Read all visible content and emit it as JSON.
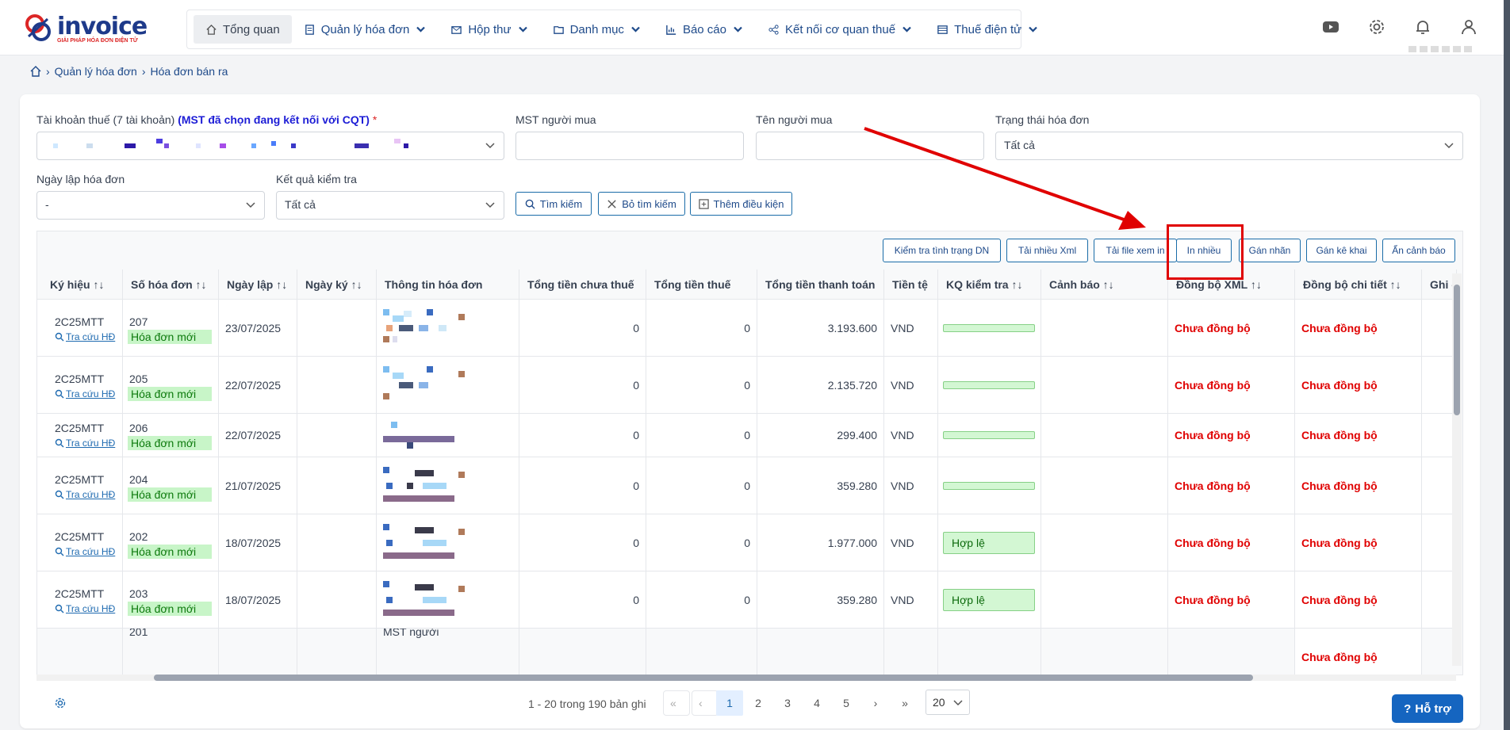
{
  "brand": {
    "name": "invoice",
    "tagline": "GIẢI PHÁP HÓA ĐƠN ĐIỆN TỬ"
  },
  "nav": {
    "items": [
      {
        "label": "Tổng quan",
        "icon": "home-icon"
      },
      {
        "label": "Quản lý hóa đơn",
        "icon": "invoice-icon"
      },
      {
        "label": "Hộp thư",
        "icon": "mail-icon"
      },
      {
        "label": "Danh mục",
        "icon": "folder-icon"
      },
      {
        "label": "Báo cáo",
        "icon": "chart-icon"
      },
      {
        "label": "Kết nối cơ quan thuế",
        "icon": "share-icon"
      },
      {
        "label": "Thuế điện tử",
        "icon": "list-icon"
      }
    ]
  },
  "breadcrumb": {
    "level1": "Quản lý hóa đơn",
    "level2": "Hóa đơn bán ra"
  },
  "filters": {
    "account_label": "Tài khoản thuế (7 tài khoản)",
    "account_highlight": "(MST đã chọn đang kết nối với CQT)",
    "required_mark": "*",
    "buyer_tax_label": "MST người mua",
    "buyer_tax_value": "",
    "buyer_name_label": "Tên người mua",
    "buyer_name_value": "",
    "status_label": "Trạng thái hóa đơn",
    "status_value": "Tất cả",
    "date_label": "Ngày lập hóa đơn",
    "date_value": "-",
    "check_label": "Kết quả kiểm tra",
    "check_value": "Tất cả",
    "search_btn": "Tìm kiếm",
    "clear_btn": "Bỏ tìm kiếm",
    "more_btn": "Thêm điều kiện"
  },
  "toolbar": {
    "check_status": "Kiểm tra tình trạng DN",
    "download_xml": "Tải nhiều Xml",
    "download_view": "Tải file xem in",
    "print_many": "In nhiều",
    "assign_label": "Gán nhãn",
    "assign_declare": "Gán kê khai",
    "hide_warning": "Ẩn cảnh báo"
  },
  "table": {
    "headers": {
      "symbol": "Ký hiệu",
      "number": "Số hóa đơn",
      "created": "Ngày lập",
      "signed": "Ngày ký",
      "info": "Thông tin hóa đơn",
      "pre_tax": "Tổng tiền chưa thuế",
      "tax": "Tổng tiền thuế",
      "total": "Tổng tiền thanh toán",
      "currency": "Tiền tệ",
      "check": "KQ kiểm tra",
      "warning": "Cảnh báo",
      "sync_xml": "Đồng bộ XML",
      "sync_detail": "Đồng bộ chi tiết",
      "note": "Ghi c"
    },
    "lookup_label": "Tra cứu HĐ",
    "rows": [
      {
        "symbol": "2C25MTT",
        "number": "207",
        "status": "Hóa đơn mới",
        "created": "23/07/2025",
        "pre_tax": "0",
        "tax": "0",
        "total": "3.193.600",
        "currency": "VND",
        "check": "",
        "sync_xml": "Chưa đồng bộ",
        "sync_detail": "Chưa đồng bộ"
      },
      {
        "symbol": "2C25MTT",
        "number": "205",
        "status": "Hóa đơn mới",
        "created": "22/07/2025",
        "pre_tax": "0",
        "tax": "0",
        "total": "2.135.720",
        "currency": "VND",
        "check": "",
        "sync_xml": "Chưa đồng bộ",
        "sync_detail": "Chưa đồng bộ"
      },
      {
        "symbol": "2C25MTT",
        "number": "206",
        "status": "Hóa đơn mới",
        "created": "22/07/2025",
        "pre_tax": "0",
        "tax": "0",
        "total": "299.400",
        "currency": "VND",
        "check": "",
        "sync_xml": "Chưa đồng bộ",
        "sync_detail": "Chưa đồng bộ"
      },
      {
        "symbol": "2C25MTT",
        "number": "204",
        "status": "Hóa đơn mới",
        "created": "21/07/2025",
        "pre_tax": "0",
        "tax": "0",
        "total": "359.280",
        "currency": "VND",
        "check": "",
        "sync_xml": "Chưa đồng bộ",
        "sync_detail": "Chưa đồng bộ"
      },
      {
        "symbol": "2C25MTT",
        "number": "202",
        "status": "Hóa đơn mới",
        "created": "18/07/2025",
        "pre_tax": "0",
        "tax": "0",
        "total": "1.977.000",
        "currency": "VND",
        "check": "Hợp lệ",
        "sync_xml": "Chưa đồng bộ",
        "sync_detail": "Chưa đồng bộ"
      },
      {
        "symbol": "2C25MTT",
        "number": "203",
        "status": "Hóa đơn mới",
        "created": "18/07/2025",
        "pre_tax": "0",
        "tax": "0",
        "total": "359.280",
        "currency": "VND",
        "check": "Hợp lệ",
        "sync_xml": "Chưa đồng bộ",
        "sync_detail": "Chưa đồng bộ"
      }
    ],
    "partial_row": {
      "number": "201",
      "info": "MST người",
      "sync_detail": "Chưa đồng bộ"
    }
  },
  "pager": {
    "info": "1 - 20 trong 190 bản ghi",
    "pages": [
      "1",
      "2",
      "3",
      "4",
      "5"
    ],
    "page_size": "20"
  },
  "help": {
    "label": "Hỗ trợ"
  },
  "colors": {
    "primary": "#1e4a8a",
    "accent_red": "#e00000",
    "valid_bg": "#d3f7d3",
    "help_bg": "#1565c0"
  }
}
